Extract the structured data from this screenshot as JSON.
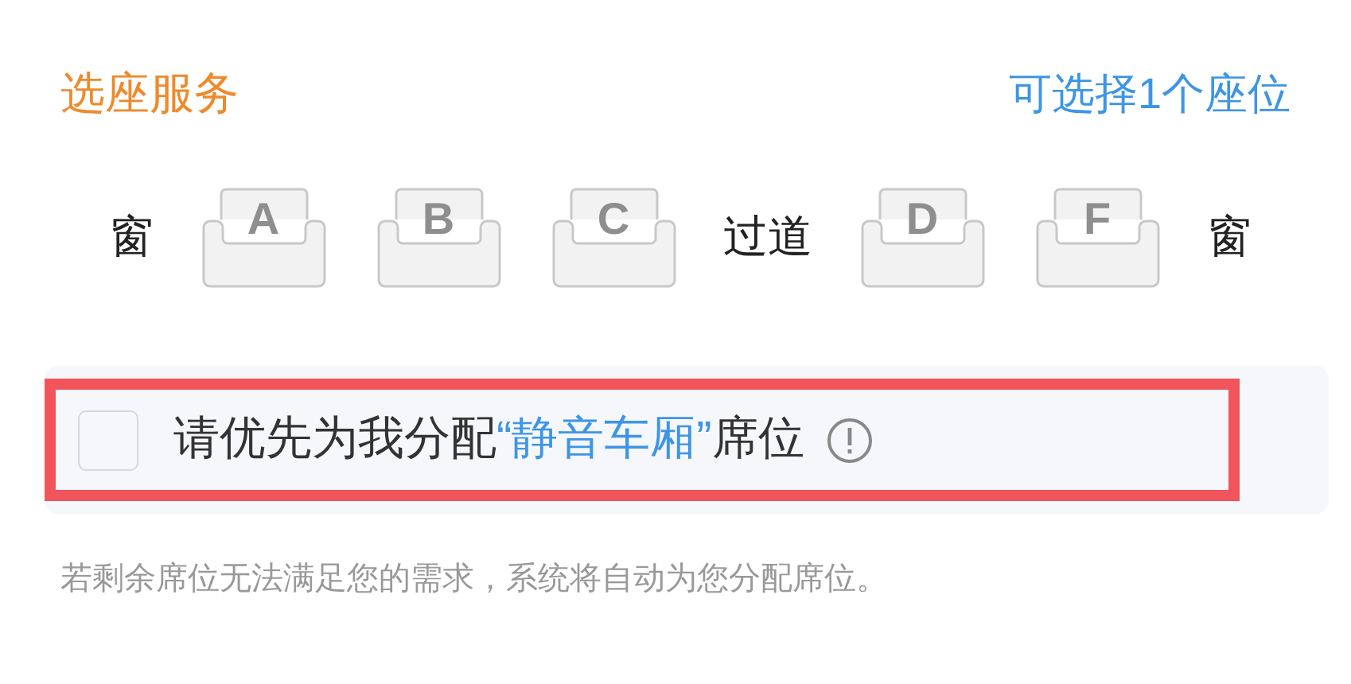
{
  "header": {
    "title": "选座服务",
    "hint": "可选择1个座位"
  },
  "seat_row": [
    {
      "kind": "side",
      "label": "窗"
    },
    {
      "kind": "seat",
      "label": "A",
      "selected": false
    },
    {
      "kind": "seat",
      "label": "B",
      "selected": false
    },
    {
      "kind": "seat",
      "label": "C",
      "selected": false
    },
    {
      "kind": "side",
      "label": "过道"
    },
    {
      "kind": "seat",
      "label": "D",
      "selected": false
    },
    {
      "kind": "seat",
      "label": "F",
      "selected": false
    },
    {
      "kind": "side",
      "label": "窗"
    }
  ],
  "quiet_option": {
    "checked": false,
    "highlighted": true,
    "segments": [
      {
        "kind": "plain",
        "text": "请优先为我分配"
      },
      {
        "kind": "accent",
        "text": "“静音车厢”"
      },
      {
        "kind": "plain",
        "text": "席位"
      }
    ]
  },
  "note": "若剩余席位无法满足您的需求，系统将自动为您分配席位。"
}
